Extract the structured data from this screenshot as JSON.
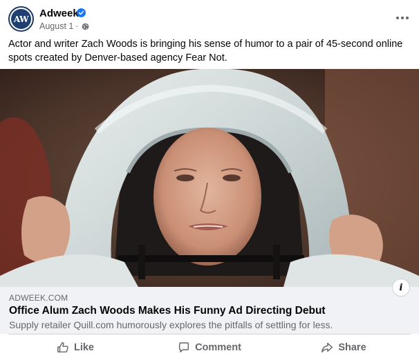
{
  "post": {
    "page_name": "Adweek",
    "avatar_text": "AW",
    "date": "August 1",
    "meta_separator": "·",
    "caption": "Actor and writer Zach Woods is bringing his sense of humor to a pair of 45-second online spots created by Denver-based agency Fear Not.",
    "image_alt": "Person wearing a white hooded suit pulling the hood over her head",
    "icons": [
      "verified-badge-icon",
      "globe-icon",
      "more-options-icon",
      "info-icon"
    ]
  },
  "link_preview": {
    "domain": "ADWEEK.COM",
    "title": "Office Alum Zach Woods Makes His Funny Ad Directing Debut",
    "description": "Supply retailer Quill.com humorously explores the pitfalls of settling for less.",
    "info_label": "i"
  },
  "actions": {
    "like_label": "Like",
    "comment_label": "Comment",
    "share_label": "Share"
  },
  "colors": {
    "primary_text": "#050505",
    "secondary_text": "#65676b",
    "link_box_bg": "#f0f2f5",
    "verified_blue": "#1877f2",
    "avatar_navy": "#1f3f70"
  }
}
